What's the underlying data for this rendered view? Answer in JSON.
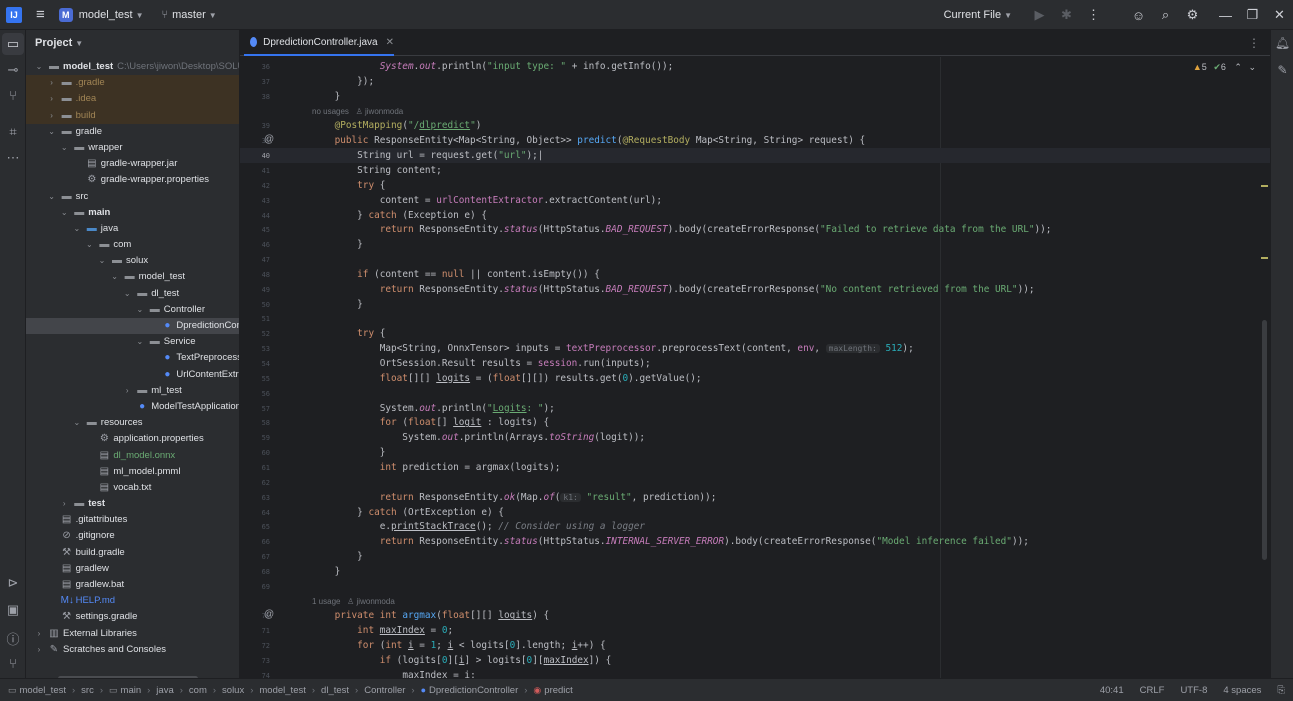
{
  "titlebar": {
    "logo": "IJ",
    "project_badge": "M",
    "project": "model_test",
    "branch": "master",
    "run_config": "Current File",
    "icons": [
      "hamburger-menu-icon",
      "branch-icon",
      "run-icon",
      "debug-icon",
      "more-icon",
      "collab-icon",
      "search-icon",
      "settings-icon",
      "minimize-icon",
      "maximize-icon",
      "close-icon"
    ]
  },
  "project_panel": {
    "title": "Project",
    "root_path": "C:\\Users\\jiwon\\Desktop\\SOLU",
    "items": [
      {
        "label": "model_test",
        "depth": 0,
        "arrow": "open",
        "icon": "folder",
        "path": true
      },
      {
        "label": ".gradle",
        "depth": 1,
        "arrow": "closed",
        "icon": "folder",
        "style": "excluded"
      },
      {
        "label": ".idea",
        "depth": 1,
        "arrow": "closed",
        "icon": "folder",
        "style": "excluded"
      },
      {
        "label": "build",
        "depth": 1,
        "arrow": "closed",
        "icon": "folder",
        "style": "excluded"
      },
      {
        "label": "gradle",
        "depth": 1,
        "arrow": "open",
        "icon": "folder"
      },
      {
        "label": "wrapper",
        "depth": 2,
        "arrow": "open",
        "icon": "folder"
      },
      {
        "label": "gradle-wrapper.jar",
        "depth": 3,
        "icon": "file"
      },
      {
        "label": "gradle-wrapper.properties",
        "depth": 3,
        "icon": "gear"
      },
      {
        "label": "src",
        "depth": 1,
        "arrow": "open",
        "icon": "folder"
      },
      {
        "label": "main",
        "depth": 2,
        "arrow": "open",
        "icon": "folder",
        "bold": true
      },
      {
        "label": "java",
        "depth": 3,
        "arrow": "open",
        "icon": "src"
      },
      {
        "label": "com",
        "depth": 4,
        "arrow": "open",
        "icon": "folder"
      },
      {
        "label": "solux",
        "depth": 5,
        "arrow": "open",
        "icon": "folder"
      },
      {
        "label": "model_test",
        "depth": 6,
        "arrow": "open",
        "icon": "folder"
      },
      {
        "label": "dl_test",
        "depth": 7,
        "arrow": "open",
        "icon": "folder"
      },
      {
        "label": "Controller",
        "depth": 8,
        "arrow": "open",
        "icon": "folder"
      },
      {
        "label": "DpredictionController",
        "depth": 9,
        "icon": "class",
        "style": "selected"
      },
      {
        "label": "Service",
        "depth": 8,
        "arrow": "open",
        "icon": "folder"
      },
      {
        "label": "TextPreprocessor",
        "depth": 9,
        "icon": "class"
      },
      {
        "label": "UrlContentExtractor",
        "depth": 9,
        "icon": "class"
      },
      {
        "label": "ml_test",
        "depth": 7,
        "arrow": "closed",
        "icon": "folder"
      },
      {
        "label": "ModelTestApplication",
        "depth": 7,
        "icon": "class"
      },
      {
        "label": "resources",
        "depth": 3,
        "arrow": "open",
        "icon": "folder"
      },
      {
        "label": "application.properties",
        "depth": 4,
        "icon": "gear"
      },
      {
        "label": "dl_model.onnx",
        "depth": 4,
        "icon": "file",
        "color": "green"
      },
      {
        "label": "ml_model.pmml",
        "depth": 4,
        "icon": "file"
      },
      {
        "label": "vocab.txt",
        "depth": 4,
        "icon": "file"
      },
      {
        "label": "test",
        "depth": 2,
        "arrow": "closed",
        "icon": "folder",
        "bold": true
      },
      {
        "label": ".gitattributes",
        "depth": 1,
        "icon": "file"
      },
      {
        "label": ".gitignore",
        "depth": 1,
        "icon": "circle"
      },
      {
        "label": "build.gradle",
        "depth": 1,
        "icon": "gradle"
      },
      {
        "label": "gradlew",
        "depth": 1,
        "icon": "file"
      },
      {
        "label": "gradlew.bat",
        "depth": 1,
        "icon": "file"
      },
      {
        "label": "HELP.md",
        "depth": 1,
        "icon": "md",
        "color": "blue"
      },
      {
        "label": "settings.gradle",
        "depth": 1,
        "icon": "gradle"
      },
      {
        "label": "External Libraries",
        "depth": 0,
        "arrow": "closed",
        "icon": "lib"
      },
      {
        "label": "Scratches and Consoles",
        "depth": 0,
        "arrow": "closed",
        "icon": "scratch"
      }
    ]
  },
  "editor": {
    "tab": "DpredictionController.java",
    "analysis": {
      "warnings": "5",
      "ok": "6"
    },
    "lines": [
      {
        "n": "36",
        "html": "            <span class=\"fld it\">System</span>.<span class=\"fld it\">out</span>.println(<span class=\"str\">\"input type: \"</span> + info.getInfo());"
      },
      {
        "n": "37",
        "html": "        });"
      },
      {
        "n": "38",
        "html": "    }"
      },
      {
        "hint": "no usages   ♙ jiwonmoda"
      },
      {
        "n": "39",
        "html": "    <span class=\"ann\">@PostMapping</span>(<span class=\"str\">\"/<span class=\"ul\">dlpredict</span>\"</span>)"
      },
      {
        "n": "39",
        "gicon": "@",
        "html": "    <span class=\"kw\">public</span> ResponseEntity&lt;Map&lt;String, Object&gt;&gt; <span class=\"fn\">predict</span>(<span class=\"ann\">@RequestBody</span> Map&lt;String, String&gt; request) {"
      },
      {
        "n": "40",
        "current": true,
        "html": "        String url = request.get(<span class=\"str\">\"url\"</span>);|"
      },
      {
        "n": "41",
        "html": "        String content;"
      },
      {
        "n": "42",
        "html": "        <span class=\"kw\">try</span> {"
      },
      {
        "n": "43",
        "html": "            content = <span class=\"fld\">urlContentExtractor</span>.extractContent(url);"
      },
      {
        "n": "44",
        "html": "        } <span class=\"kw\">catch</span> (Exception e) {"
      },
      {
        "n": "45",
        "html": "            <span class=\"kw\">return</span> ResponseEntity.<span class=\"it\">status</span>(HttpStatus.<span class=\"it\">BAD_REQUEST</span>).body(createErrorResponse(<span class=\"str\">\"Failed to retrieve data from the URL\"</span>));"
      },
      {
        "n": "46",
        "html": "        }"
      },
      {
        "n": "47",
        "html": ""
      },
      {
        "n": "48",
        "html": "        <span class=\"kw\">if</span> (content == <span class=\"kw\">null</span> || content.isEmpty()) {"
      },
      {
        "n": "49",
        "html": "            <span class=\"kw\">return</span> ResponseEntity.<span class=\"it\">status</span>(HttpStatus.<span class=\"it\">BAD_REQUEST</span>).body(createErrorResponse(<span class=\"str\">\"No content retrieved from the URL\"</span>));"
      },
      {
        "n": "50",
        "html": "        }"
      },
      {
        "n": "51",
        "html": ""
      },
      {
        "n": "52",
        "html": "        <span class=\"kw\">try</span> {"
      },
      {
        "n": "53",
        "html": "            Map&lt;String, OnnxTensor&gt; inputs = <span class=\"fld\">textPreprocessor</span>.preprocessText(content, <span class=\"fld\">env</span>, <span class=\"inlay\">maxLength:</span> <span class=\"num\">512</span>);"
      },
      {
        "n": "54",
        "html": "            OrtSession.Result results = <span class=\"fld\">session</span>.run(inputs);"
      },
      {
        "n": "55",
        "html": "            <span class=\"kw\">float</span>[][] <span class=\"ul\">logits</span> = (<span class=\"kw\">float</span>[][]) results.get(<span class=\"num\">0</span>).getValue();"
      },
      {
        "n": "56",
        "html": ""
      },
      {
        "n": "57",
        "html": "            System.<span class=\"it\">out</span>.println(<span class=\"str\">\"<span class=\"ul\">Logits</span>: \"</span>);"
      },
      {
        "n": "58",
        "html": "            <span class=\"kw\">for</span> (<span class=\"kw\">float</span>[] <span class=\"ul\">logit</span> : logits) {"
      },
      {
        "n": "59",
        "html": "                System.<span class=\"it\">out</span>.println(Arrays.<span class=\"it\">toString</span>(logit));"
      },
      {
        "n": "60",
        "html": "            }"
      },
      {
        "n": "61",
        "html": "            <span class=\"kw\">int</span> prediction = argmax(logits);"
      },
      {
        "n": "62",
        "html": ""
      },
      {
        "n": "63",
        "html": "            <span class=\"kw\">return</span> ResponseEntity.<span class=\"it\">ok</span>(Map.<span class=\"it\">of</span>(<span class=\"inlay\">k1:</span> <span class=\"str\">\"result\"</span>, prediction));"
      },
      {
        "n": "64",
        "html": "        } <span class=\"kw\">catch</span> (OrtException e) {"
      },
      {
        "n": "65",
        "html": "            e.<span class=\"ul\">printStackTrace</span>(); <span class=\"cm\">// Consider using a logger</span>"
      },
      {
        "n": "66",
        "html": "            <span class=\"kw\">return</span> ResponseEntity.<span class=\"it\">status</span>(HttpStatus.<span class=\"it\">INTERNAL_SERVER_ERROR</span>).body(createErrorResponse(<span class=\"str\">\"Model inference failed\"</span>));"
      },
      {
        "n": "67",
        "html": "        }"
      },
      {
        "n": "68",
        "html": "    }"
      },
      {
        "n": "69",
        "html": ""
      },
      {
        "hint": "1 usage   ♙ jiwonmoda"
      },
      {
        "n": "70",
        "gicon": "@",
        "html": "    <span class=\"kw\">private int</span> <span class=\"fn\">argmax</span>(<span class=\"kw\">float</span>[][] <span class=\"ul\">logits</span>) {"
      },
      {
        "n": "71",
        "html": "        <span class=\"kw\">int</span> <span class=\"ul\">maxIndex</span> = <span class=\"num\">0</span>;"
      },
      {
        "n": "72",
        "html": "        <span class=\"kw\">for</span> (<span class=\"kw\">int</span> <span class=\"ul\">i</span> = <span class=\"num\">1</span>; <span class=\"ul\">i</span> &lt; logits[<span class=\"num\">0</span>].length; <span class=\"ul\">i</span>++) {"
      },
      {
        "n": "73",
        "html": "            <span class=\"kw\">if</span> (logits[<span class=\"num\">0</span>][<span class=\"ul\">i</span>] &gt; logits[<span class=\"num\">0</span>][<span class=\"ul\">maxIndex</span>]) {"
      },
      {
        "n": "74",
        "html": "                <span class=\"ul\">maxIndex</span> = <span class=\"ul\">i</span>;"
      }
    ]
  },
  "statusbar": {
    "breadcrumbs": [
      "model_test",
      "src",
      "main",
      "java",
      "com",
      "solux",
      "model_test",
      "dl_test",
      "Controller",
      "DpredictionController",
      "predict"
    ],
    "position": "40:41",
    "line_sep": "CRLF",
    "encoding": "UTF-8",
    "indent": "4 spaces"
  }
}
